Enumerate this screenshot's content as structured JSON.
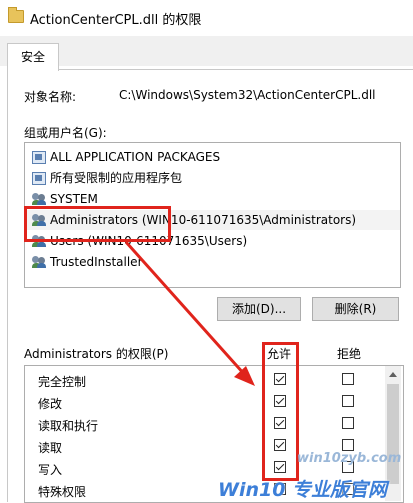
{
  "window": {
    "title": "ActionCenterCPL.dll 的权限",
    "title_icon": "folder-icon"
  },
  "tabs": [
    {
      "label": "安全"
    }
  ],
  "object": {
    "label": "对象名称:",
    "value": "C:\\Windows\\System32\\ActionCenterCPL.dll"
  },
  "groups": {
    "label": "组或用户名(G):",
    "items": [
      {
        "label": "ALL APPLICATION PACKAGES",
        "icon": "package-icon"
      },
      {
        "label": "所有受限制的应用程序包",
        "icon": "package-icon"
      },
      {
        "label": "SYSTEM",
        "icon": "user-group-icon"
      },
      {
        "label": "Administrators (WIN10-611071635\\Administrators)",
        "icon": "user-group-icon",
        "selected": true
      },
      {
        "label": "Users (WIN10-611071635\\Users)",
        "icon": "user-group-icon"
      },
      {
        "label": "TrustedInstaller",
        "icon": "user-group-icon"
      }
    ]
  },
  "buttons": {
    "add": "添加(D)...",
    "remove": "删除(R)"
  },
  "permissions": {
    "label": "Administrators 的权限(P)",
    "allow_header": "允许",
    "deny_header": "拒绝",
    "rows": [
      {
        "name": "完全控制",
        "allow": true,
        "deny": false
      },
      {
        "name": "修改",
        "allow": true,
        "deny": false
      },
      {
        "name": "读取和执行",
        "allow": true,
        "deny": false
      },
      {
        "name": "读取",
        "allow": true,
        "deny": false
      },
      {
        "name": "写入",
        "allow": true,
        "deny": false
      },
      {
        "name": "特殊权限",
        "allow": false,
        "deny": false
      }
    ]
  },
  "annotation_color": "#e0241c",
  "watermark": {
    "site": "win10zyb.com",
    "brand": "Win10 专业版官网"
  }
}
